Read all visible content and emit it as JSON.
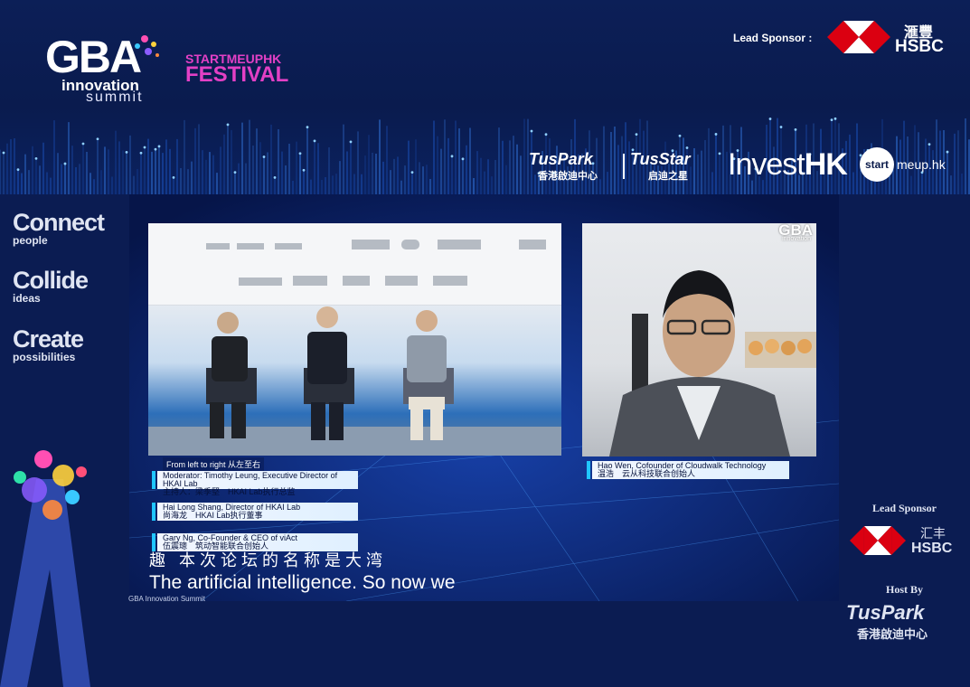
{
  "header": {
    "gba_logo_main": "GBA",
    "gba_logo_line2": "innovation",
    "gba_logo_line3": "summit",
    "festival_line1": "STARTMEUPHK",
    "festival_line2": "FESTIVAL",
    "lead_sponsor_label": "Lead Sponsor :",
    "hsbc_cn": "滙豐",
    "hsbc_en": "HSBC",
    "tuspark": "TusPark",
    "tuspark_cn": "香港啟迪中心",
    "tusstar": "TusStar",
    "tusstar_cn": "启迪之星",
    "investhk_light": "Invest",
    "investhk_bold": "HK",
    "start_circle": "start",
    "startmeup": "meup.hk"
  },
  "left_taglines": [
    {
      "big": "Connect",
      "small": "people"
    },
    {
      "big": "Collide",
      "small": "ideas"
    },
    {
      "big": "Create",
      "small": "possibilities"
    }
  ],
  "right_sidebar": {
    "lead_sponsor_label": "Lead Sponsor",
    "hsbc_cn": "汇丰",
    "hsbc_en": "HSBC",
    "host_label": "Host By",
    "host_name": "TusPark",
    "host_cn": "香港啟迪中心"
  },
  "video": {
    "gba_watermark": "GBA",
    "gba_watermark_sub": "innovation",
    "caption_heading": "From left to right 从左至右",
    "panelists": [
      {
        "en": "Moderator: Timothy Leung, Executive Director of HKAI Lab",
        "cn": "主持人：梁季堅　HKAI Lab执行总监"
      },
      {
        "en": "Hai Long Shang, Director of HKAI Lab",
        "cn": "尚海龙　HKAI Lab执行董事"
      },
      {
        "en": "Gary Ng, Co-Founder & CEO of viAct",
        "cn": "伍震璁　筑动智能联合创始人"
      }
    ],
    "guest": {
      "en": "Hao Wen, Cofounder of Cloudwalk Technology",
      "cn": "温浩　云从科技联合创始人"
    },
    "subtitle_cn": "趣 本次论坛的名称是大湾",
    "subtitle_en": "The artificial intelligence. So now we",
    "watermark": "GBA Innovation Summit"
  },
  "colors": {
    "background": "#0a1a4a",
    "festival_pink": "#e340c5",
    "hsbc_red": "#db0011",
    "caption_cyan": "#20c6ff"
  }
}
